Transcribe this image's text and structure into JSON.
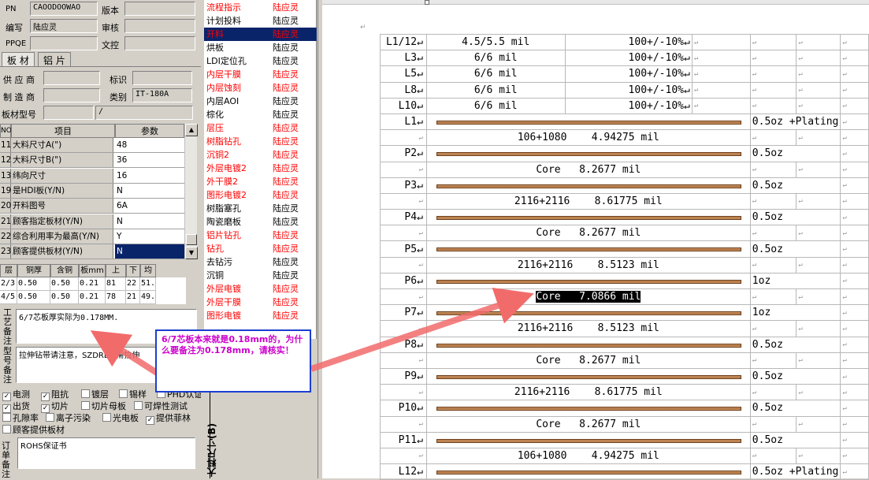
{
  "header": {
    "pn_label": "PN",
    "pn_value": "CAOODOOWAO",
    "version_label": "版本",
    "code_label": "编写",
    "code_value": "陆应灵",
    "review_label": "审核",
    "ppqe_label": "PPQE",
    "archive_label": "文控"
  },
  "tabs": [
    "板 材",
    "铝 片"
  ],
  "material": {
    "supplier_label": "供 应 商",
    "mark_label": "标识",
    "maker_label": "制 造 商",
    "category_label": "类别",
    "category_value": "IT-180A",
    "model_label": "板材型号",
    "model_value": "/"
  },
  "grid": {
    "headers": [
      "NO",
      "项目",
      "参数"
    ],
    "rows": [
      {
        "no": "11",
        "item": "大料尺寸A(\")",
        "value": "48"
      },
      {
        "no": "12",
        "item": "大料尺寸B(\")",
        "value": "36"
      },
      {
        "no": "13",
        "item": "纬向尺寸",
        "value": "16"
      },
      {
        "no": "19",
        "item": "是HDI板(Y/N)",
        "value": "N"
      },
      {
        "no": "20",
        "item": "开料图号",
        "value": "6A"
      },
      {
        "no": "21",
        "item": "顾客指定板材(Y/N)",
        "value": "N"
      },
      {
        "no": "22",
        "item": "综合利用率为最高(Y/N)",
        "value": "Y"
      },
      {
        "no": "23",
        "item": "顾客提供板材(Y/N)",
        "value": "N"
      }
    ]
  },
  "layer_table": {
    "headers": [
      "层",
      "铜厚(OZ)",
      "含铜mm",
      "板mm",
      "上",
      "下",
      "均"
    ],
    "rows": [
      [
        "2/3",
        "0.50",
        "0.50",
        "0.21",
        "81",
        "22",
        "51."
      ],
      [
        "4/5",
        "0.50",
        "0.50",
        "0.21",
        "78",
        "21",
        "49."
      ]
    ]
  },
  "remarks": {
    "process_label": "工艺备注",
    "process_value": "6/7芯板厚实际为0.178MM.",
    "type_label": "型号备注",
    "type_value": "拉伸钻带请注意，SZDRL也需拉伸",
    "order_label": "订单备注",
    "order_value": "ROHS保证书"
  },
  "checks": [
    {
      "label": "电测",
      "checked": true
    },
    {
      "label": "阻抗",
      "checked": true
    },
    {
      "label": "镀层",
      "checked": false
    },
    {
      "label": "锡样",
      "checked": false
    },
    {
      "label": "PHD认证",
      "checked": false
    },
    {
      "label": "出货",
      "checked": true
    },
    {
      "label": "切片",
      "checked": true
    },
    {
      "label": "切片母板",
      "checked": false
    },
    {
      "label": "可焊性测试",
      "checked": false
    },
    {
      "label": "孔隙率",
      "checked": false
    },
    {
      "label": "离子污染",
      "checked": false
    },
    {
      "label": "光电板",
      "checked": false
    },
    {
      "label": "提供菲林",
      "checked": true
    },
    {
      "label": "顾客提供板材",
      "checked": false
    }
  ],
  "vertical_label": "大料尺寸(B)",
  "process_list": [
    {
      "name": "流程指示",
      "person": "陆应灵",
      "red": true
    },
    {
      "name": "计划投料",
      "person": "陆应灵",
      "red": false
    },
    {
      "name": "开料",
      "person": "陆应灵",
      "red": true,
      "selected": true
    },
    {
      "name": "烘板",
      "person": "陆应灵",
      "red": false
    },
    {
      "name": "LDI定位孔",
      "person": "陆应灵",
      "red": false
    },
    {
      "name": "内层干膜",
      "person": "陆应灵",
      "red": true
    },
    {
      "name": "内层蚀刻",
      "person": "陆应灵",
      "red": true
    },
    {
      "name": "内层AOI",
      "person": "陆应灵",
      "red": false
    },
    {
      "name": "棕化",
      "person": "陆应灵",
      "red": false
    },
    {
      "name": "层压",
      "person": "陆应灵",
      "red": true
    },
    {
      "name": "树脂钻孔",
      "person": "陆应灵",
      "red": true
    },
    {
      "name": "沉铜2",
      "person": "陆应灵",
      "red": true
    },
    {
      "name": "外层电镀2",
      "person": "陆应灵",
      "red": true
    },
    {
      "name": "外干膜2",
      "person": "陆应灵",
      "red": true
    },
    {
      "name": "图形电镀2",
      "person": "陆应灵",
      "red": true
    },
    {
      "name": "树脂塞孔",
      "person": "陆应灵",
      "red": false
    },
    {
      "name": "陶瓷磨板",
      "person": "陆应灵",
      "red": false
    },
    {
      "name": "铝片钻孔",
      "person": "陆应灵",
      "red": true
    },
    {
      "name": "钻孔",
      "person": "陆应灵",
      "red": true
    },
    {
      "name": "去钻污",
      "person": "陆应灵",
      "red": false
    },
    {
      "name": "沉铜",
      "person": "陆应灵",
      "red": false
    },
    {
      "name": "外层电镀",
      "person": "陆应灵",
      "red": true
    },
    {
      "name": "外层干膜",
      "person": "陆应灵",
      "red": true
    },
    {
      "name": "图形电镀",
      "person": "陆应灵",
      "red": true
    }
  ],
  "stackup": {
    "rows": [
      {
        "type": "imp",
        "layer": "L1/12",
        "spec": "4.5/5.5 mil",
        "tol": "100+/-10%"
      },
      {
        "type": "imp",
        "layer": "L3",
        "spec": "6/6 mil",
        "tol": "100+/-10%"
      },
      {
        "type": "imp",
        "layer": "L5",
        "spec": "6/6 mil",
        "tol": "100+/-10%"
      },
      {
        "type": "imp",
        "layer": "L8",
        "spec": "6/6 mil",
        "tol": "100+/-10%"
      },
      {
        "type": "imp",
        "layer": "L10",
        "spec": "6/6 mil",
        "tol": "100+/-10%"
      },
      {
        "type": "cu",
        "layer": "L1",
        "oz": "0.5oz +Plating"
      },
      {
        "type": "di",
        "text": "106+1080    4.94275 mil"
      },
      {
        "type": "cu",
        "layer": "P2",
        "oz": "0.5oz"
      },
      {
        "type": "di",
        "text": "Core   8.2677 mil"
      },
      {
        "type": "cu",
        "layer": "P3",
        "oz": "0.5oz"
      },
      {
        "type": "di",
        "text": "2116+2116    8.61775 mil"
      },
      {
        "type": "cu",
        "layer": "P4",
        "oz": "0.5oz"
      },
      {
        "type": "di",
        "text": "Core   8.2677 mil"
      },
      {
        "type": "cu",
        "layer": "P5",
        "oz": "0.5oz"
      },
      {
        "type": "di",
        "text": "2116+2116    8.5123 mil"
      },
      {
        "type": "cu",
        "layer": "P6",
        "oz": "1oz"
      },
      {
        "type": "di",
        "text": "Core   7.0866 mil",
        "highlight": true
      },
      {
        "type": "cu",
        "layer": "P7",
        "oz": "1oz"
      },
      {
        "type": "di",
        "text": "2116+2116    8.5123 mil"
      },
      {
        "type": "cu",
        "layer": "P8",
        "oz": "0.5oz"
      },
      {
        "type": "di",
        "text": "Core   8.2677 mil"
      },
      {
        "type": "cu",
        "layer": "P9",
        "oz": "0.5oz"
      },
      {
        "type": "di",
        "text": "2116+2116    8.61775 mil"
      },
      {
        "type": "cu",
        "layer": "P10",
        "oz": "0.5oz"
      },
      {
        "type": "di",
        "text": "Core   8.2677 mil"
      },
      {
        "type": "cu",
        "layer": "P11",
        "oz": "0.5oz"
      },
      {
        "type": "di",
        "text": "106+1080    4.94275 mil"
      },
      {
        "type": "cu",
        "layer": "L12",
        "oz": "0.5oz +Plating"
      }
    ]
  },
  "annotation": {
    "text": "6/7芯板本来就是0.18mm的，为什么要备注为0.178mm，请核实！",
    "color": "#cc00cc",
    "border": "#1c3fcf",
    "arrow_color": "#f26b6b"
  }
}
